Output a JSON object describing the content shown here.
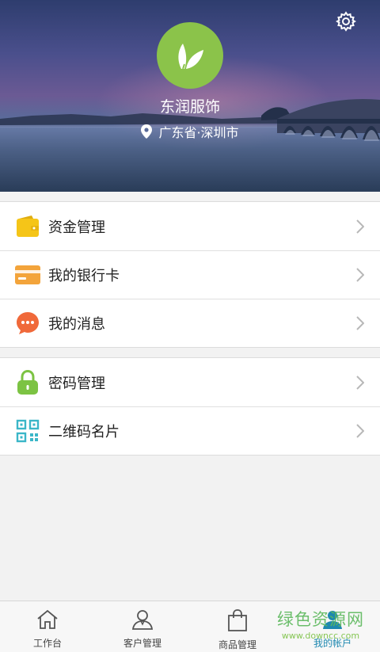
{
  "header": {
    "shop_name": "东润服饰",
    "location": "广东省·深圳市",
    "accent": "#8bc34a"
  },
  "menu_group_1": [
    {
      "label": "资金管理",
      "icon": "wallet-icon",
      "color": "#f5c518"
    },
    {
      "label": "我的银行卡",
      "icon": "bank-card-icon",
      "color": "#f3a43b"
    },
    {
      "label": "我的消息",
      "icon": "message-icon",
      "color": "#f0693a"
    }
  ],
  "menu_group_2": [
    {
      "label": "密码管理",
      "icon": "lock-icon",
      "color": "#7cc343"
    },
    {
      "label": "二维码名片",
      "icon": "qr-code-icon",
      "color": "#3bb6c8"
    }
  ],
  "tabs": [
    {
      "label": "工作台",
      "icon": "home-icon"
    },
    {
      "label": "客户管理",
      "icon": "customer-icon"
    },
    {
      "label": "商品管理",
      "icon": "shopping-bag-icon"
    },
    {
      "label": "我的帐户",
      "icon": "account-icon",
      "active": true
    }
  ],
  "watermark": {
    "main": "绿色资源网",
    "sub": "www.downcc.com"
  }
}
